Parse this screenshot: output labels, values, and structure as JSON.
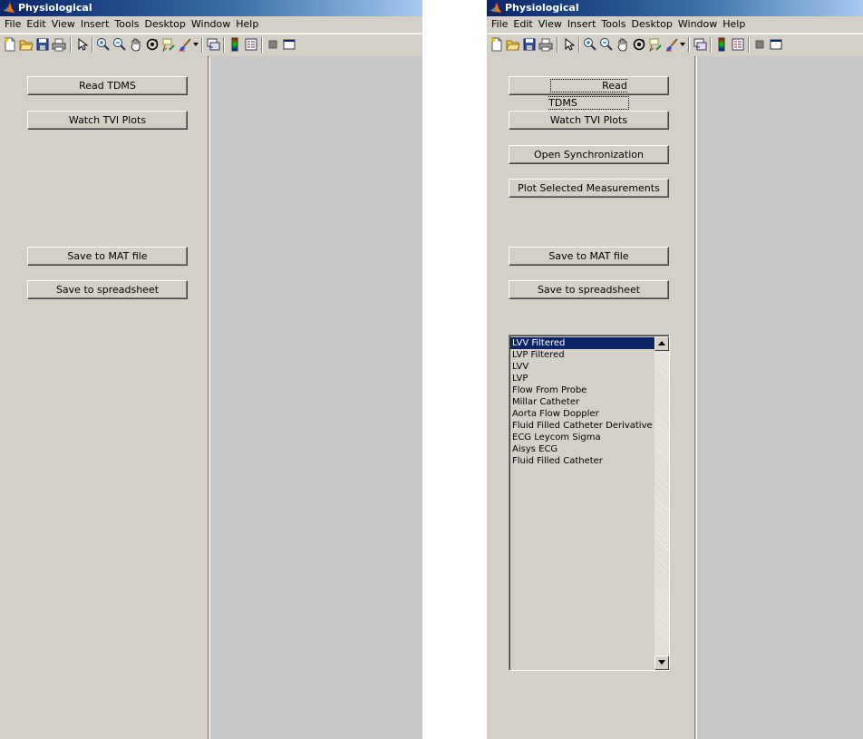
{
  "app_title": "Physiological",
  "menu": [
    "File",
    "Edit",
    "View",
    "Insert",
    "Tools",
    "Desktop",
    "Window",
    "Help"
  ],
  "toolbar_icons": [
    "new-figure-icon",
    "open-file-icon",
    "save-icon",
    "print-icon",
    "edit-plot-arrow-icon",
    "zoom-in-icon",
    "zoom-out-icon",
    "pan-hand-icon",
    "rotate-3d-icon",
    "data-cursor-icon",
    "brush-icon",
    "link-plot-icon",
    "colorbar-icon",
    "legend-icon",
    "hide-plot-tools-icon",
    "show-plot-tools-icon"
  ],
  "window1": {
    "buttons": {
      "read_tdms": "Read TDMS",
      "watch_tvi": "Watch TVI Plots",
      "save_mat": "Save to MAT file",
      "save_spreadsheet": "Save to spreadsheet"
    }
  },
  "window2": {
    "buttons": {
      "read_tdms": "Read TDMS",
      "watch_tvi": "Watch TVI Plots",
      "open_sync": "Open Synchronization",
      "plot_selected": "Plot Selected Measurements",
      "save_mat": "Save to MAT file",
      "save_spreadsheet": "Save to spreadsheet"
    },
    "measurements": [
      "LVV Filtered",
      "LVP Filtered",
      "LVV",
      "LVP",
      "Flow From Probe",
      "Millar Catheter",
      "Aorta Flow Doppler",
      "Fluid Filled Catheter Derivative",
      "ECG Leycom Sigma",
      "Aisys ECG",
      "Fluid Filled Catheter"
    ],
    "selected_measurement": "LVV Filtered"
  },
  "colors": {
    "title_bar": "#0a246a",
    "selection": "#0a246a",
    "face": "#d4d0c8",
    "axes_background": "#c8c8c8"
  }
}
